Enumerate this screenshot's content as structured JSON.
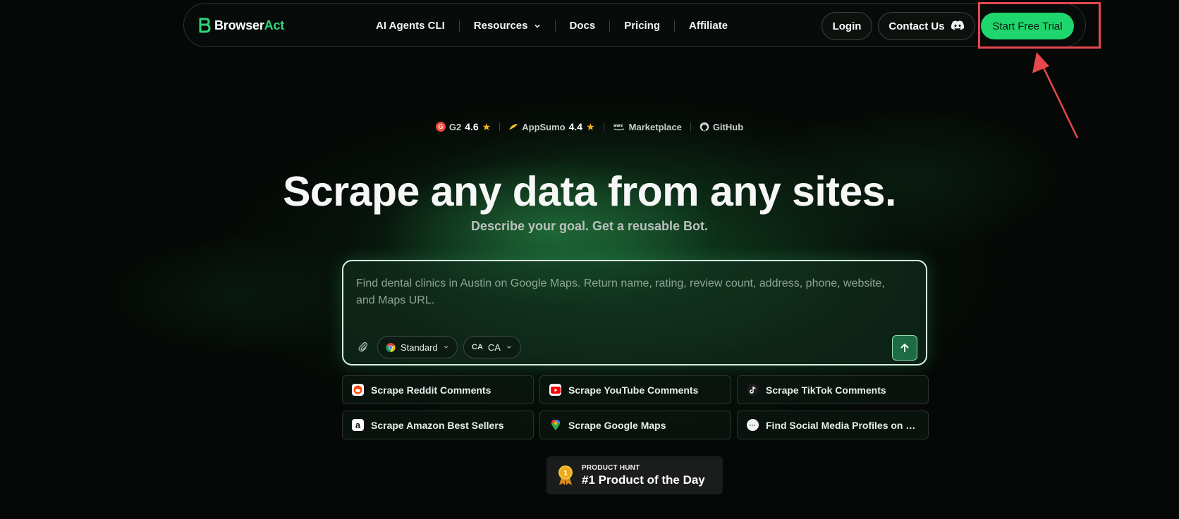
{
  "brand": {
    "name_main": "Browser",
    "name_accent": "Act",
    "accent_color": "#2fd67a"
  },
  "nav": {
    "items": [
      {
        "label": "AI Agents CLI"
      },
      {
        "label": "Resources"
      },
      {
        "label": "Docs"
      },
      {
        "label": "Pricing"
      },
      {
        "label": "Affiliate"
      }
    ],
    "login_label": "Login",
    "contact_label": "Contact Us",
    "trial_label": "Start Free Trial",
    "trial_color": "#1fd66e"
  },
  "ratings": {
    "g2": {
      "label": "G2",
      "score": "4.6"
    },
    "appsumo": {
      "label": "AppSumo",
      "score": "4.4"
    },
    "aws": {
      "label": "Marketplace",
      "icon": "aws-icon"
    },
    "github": {
      "label": "GitHub",
      "icon": "github-icon"
    }
  },
  "hero": {
    "title": "Scrape any data from any sites.",
    "subtitle": "Describe your goal. Get a reusable Bot."
  },
  "prompt": {
    "placeholder": "Find dental clinics in Austin on Google Maps. Return name, rating, review count, address, phone, website, and Maps URL.",
    "mode_label": "Standard",
    "region_badge": "CA",
    "region_label": "CA"
  },
  "suggestions": [
    {
      "label": "Scrape Reddit Comments",
      "icon": "reddit-icon"
    },
    {
      "label": "Scrape YouTube Comments",
      "icon": "youtube-icon"
    },
    {
      "label": "Scrape TikTok Comments",
      "icon": "tiktok-icon"
    },
    {
      "label": "Scrape Amazon Best Sellers",
      "icon": "amazon-icon"
    },
    {
      "label": "Scrape Google Maps",
      "icon": "google-maps-icon"
    },
    {
      "label": "Find Social Media Profiles on Go...",
      "icon": "link-icon"
    }
  ],
  "product_hunt": {
    "small": "PRODUCT HUNT",
    "big": "#1 Product of the Day",
    "medal_number": "1"
  }
}
